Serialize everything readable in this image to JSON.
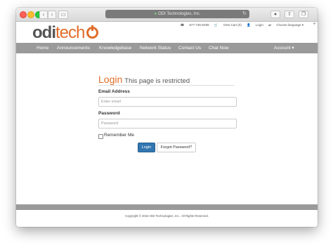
{
  "browser": {
    "url_text": "ODI Technologies, Inc.",
    "icons": {
      "back": "chevron-left-icon",
      "forward": "chevron-right-icon",
      "sidebar": "sidebar-icon",
      "reload": "reload-icon",
      "lock": "lock-icon",
      "share": "share-icon",
      "tabs": "tabs-icon",
      "new_tab": "plus-icon"
    }
  },
  "header": {
    "logo_text": "odi",
    "logo_text_2": "tech",
    "phone": "877-735-9299",
    "cart": "View Cart (0)",
    "login_link": "Login",
    "language": "Choose language"
  },
  "nav": {
    "items": [
      "Home",
      "Announcements",
      "Knowledgebase",
      "Network Status",
      "Contact Us",
      "Chat Now"
    ],
    "account": "Account"
  },
  "login": {
    "title": "Login",
    "subtitle": "This page is restricted",
    "email_label": "Email Address",
    "email_placeholder": "Enter email",
    "password_label": "Password",
    "password_placeholder": "Password",
    "remember_label": "Remember Me",
    "login_button": "Login",
    "forgot_button": "Forgot Password?"
  },
  "footer": {
    "copyright": "Copyright © 2015 ODI Technologies, Inc.. All Rights Reserved."
  },
  "colors": {
    "accent": "#e06d2a",
    "nav_bg": "#9a9a9a",
    "primary_button": "#3276b1"
  }
}
